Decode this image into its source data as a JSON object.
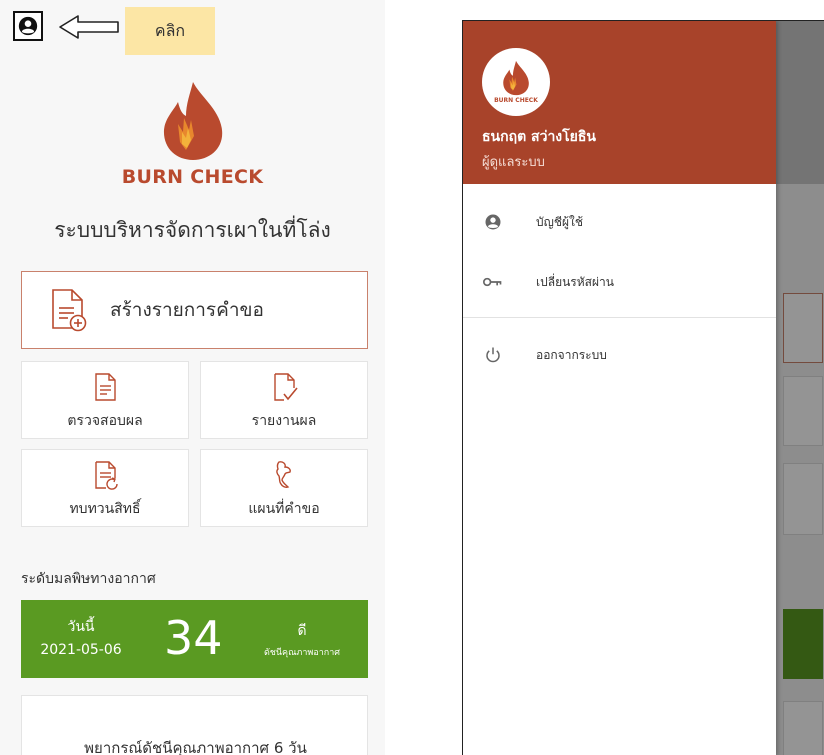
{
  "hint": {
    "label": "คลิก"
  },
  "home": {
    "brand": "BURN CHECK",
    "system_title": "ระบบบริหารจัดการเผาในที่โล่ง",
    "create_request_label": "สร้างรายการคำขอ",
    "tiles": [
      {
        "label": "ตรวจสอบผล",
        "icon": "document-icon"
      },
      {
        "label": "รายงานผล",
        "icon": "document-check-icon"
      },
      {
        "label": "ทบทวนสิทธิ์",
        "icon": "document-refresh-icon"
      },
      {
        "label": "แผนที่คำขอ",
        "icon": "thailand-map-icon"
      }
    ],
    "air_quality": {
      "heading": "ระดับมลพิษทางอากาศ",
      "today_label": "วันนี้",
      "date": "2021-05-06",
      "value": "34",
      "quality": "ดี",
      "index_label": "ดัชนีคุณภาพอากาศ",
      "color": "#5a9a22"
    },
    "forecast_label": "พยากรณ์ดัชนีคุณภาพอากาศ 6 วัน"
  },
  "drawer": {
    "avatar_brand": "BURN CHECK",
    "user_name": "ธนกฤต สว่างโยธิน",
    "user_role": "ผู้ดูแลระบบ",
    "header_color": "#a8432a",
    "menu": [
      {
        "label": "บัญชีผู้ใช้",
        "icon": "account-icon"
      },
      {
        "label": "เปลี่ยนรหัสผ่าน",
        "icon": "key-icon"
      },
      {
        "label": "ออกจากระบบ",
        "icon": "power-icon"
      }
    ]
  },
  "colors": {
    "brand": "#b94a2e",
    "hint_bg": "#fce6a5"
  }
}
